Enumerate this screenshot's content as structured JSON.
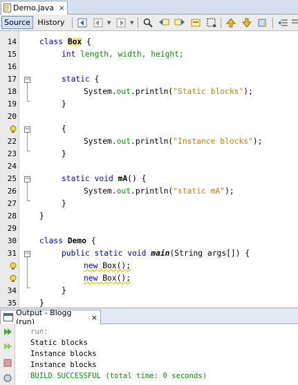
{
  "file_tab": {
    "name": "Demo.java",
    "close": "×"
  },
  "toolbar": {
    "source_label": "Source",
    "history_label": "History"
  },
  "editor": {
    "lines": [
      {
        "num": "14"
      },
      {
        "num": "15"
      },
      {
        "num": "16"
      },
      {
        "num": "17"
      },
      {
        "num": "18"
      },
      {
        "num": "19"
      },
      {
        "num": "20"
      },
      {
        "num": "21"
      },
      {
        "num": "22"
      },
      {
        "num": "23"
      },
      {
        "num": "24"
      },
      {
        "num": "25"
      },
      {
        "num": "26"
      },
      {
        "num": "27"
      },
      {
        "num": "28"
      },
      {
        "num": "29"
      },
      {
        "num": "30"
      },
      {
        "num": "31"
      },
      {
        "num": "32"
      },
      {
        "num": "33"
      },
      {
        "num": "34"
      },
      {
        "num": "35"
      }
    ],
    "tokens": {
      "class": "class",
      "box": "Box",
      "brace_open": "{",
      "brace_close": "}",
      "int": "int",
      "fields": "length, width, height;",
      "static": "static",
      "system": "System.",
      "out": "out",
      "println": ".println(",
      "str_static_blocks": "\"Static blocks\"",
      "str_instance_blocks": "\"Instance blocks\"",
      "str_static_ma": "\"static mA\"",
      "close_call": ");",
      "void": "void",
      "ma": "mA",
      "paren_open_brace": "() {",
      "demo": "Demo",
      "public": "public",
      "main": "main",
      "main_args": "(String args[]) {",
      "new": "new",
      "box_call": "Box();"
    }
  },
  "output": {
    "tab_label": "Output - Blogg (run)",
    "close": "×",
    "lines": [
      "run:",
      "Static blocks",
      "Instance blocks",
      "Instance blocks",
      "BUILD SUCCESSFUL (total time: 0 seconds)"
    ]
  },
  "colors": {
    "keyword": "#0000e6",
    "string": "#ce7b00",
    "field": "#009900",
    "build_success": "#009900"
  },
  "icons": [
    "java-file-icon",
    "back-icon",
    "forward-icon",
    "find-icon",
    "prev-occurrence-icon",
    "next-occurrence-icon",
    "toggle-highlight-icon",
    "toggle-rect-select-icon",
    "prev-bookmark-icon",
    "next-bookmark-icon",
    "toggle-bookmark-icon",
    "shift-left-icon",
    "output-icon",
    "rerun-icon",
    "rerun-different-icon",
    "stop-icon",
    "settings-icon"
  ]
}
